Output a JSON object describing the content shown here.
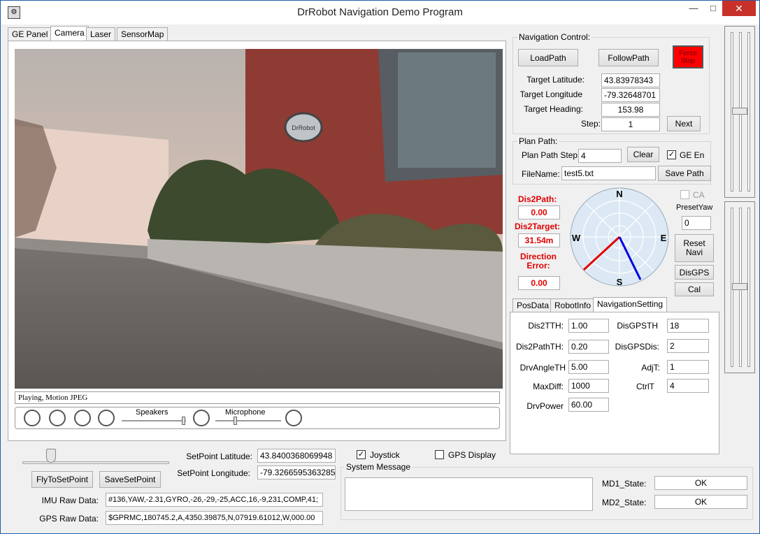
{
  "window": {
    "title": "DrRobot Navigation Demo Program",
    "minimize": "—",
    "maximize": "□",
    "close": "✕"
  },
  "tabs": [
    "GE Panel",
    "Camera",
    "Laser",
    "SensorMap"
  ],
  "camera": {
    "status": "Playing, Motion JPEG",
    "speakers_label": "Speakers",
    "microphone_label": "Microphone",
    "building_sign": "DrRobot"
  },
  "navigation_control": {
    "group_label": "Navigation Control:",
    "load_path": "LoadPath",
    "follow_path": "FollowPath",
    "force_stop": "Force Stop",
    "target_latitude_label": "Target Latitude:",
    "target_latitude": "43.83978343",
    "target_longitude_label": "Target Longitude",
    "target_longitude": "-79.32648701",
    "target_heading_label": "Target Heading:",
    "target_heading": "153.98",
    "step_label": "Step:",
    "step": "1",
    "next": "Next"
  },
  "plan_path": {
    "group_label": "Plan Path:",
    "step_label": "Plan Path Step :",
    "step": "4",
    "clear": "Clear",
    "ge_en_label": "GE En",
    "ge_en_checked": "✓",
    "filename_label": "FileName:",
    "filename": "test5.txt",
    "save_path": "Save Path"
  },
  "status": {
    "dis2path_label": "Dis2Path:",
    "dis2path": "0.00",
    "dis2target_label": "Dis2Target:",
    "dis2target": "31.54m",
    "direction_error_label": "Direction Error:",
    "direction_error": "0.00"
  },
  "compass": {
    "n": "N",
    "s": "S",
    "e": "E",
    "w": "W"
  },
  "right_controls": {
    "ca_label": "CA",
    "preset_yaw_label": "PresetYaw",
    "preset_yaw": "0",
    "reset_navi": "Reset Navi",
    "dis_gps": "DisGPS",
    "cal": "Cal"
  },
  "subtabs": [
    "PosData",
    "RobotInfo",
    "NavigationSetting"
  ],
  "nav_setting": {
    "dis2tth_label": "Dis2TTH:",
    "dis2tth": "1.00",
    "dis2pathth_label": "Dis2PathTH:",
    "dis2pathth": "0.20",
    "drvangleth_label": "DrvAngleTH",
    "drvangleth": "5.00",
    "maxdiff_label": "MaxDiff:",
    "maxdiff": "1000",
    "drvpower_label": "DrvPower",
    "drvpower": "60.00",
    "disgpsth_label": "DisGPSTH",
    "disgpsth": "18",
    "disgpsdis_label": "DisGPSDis:",
    "disgpsdis": "2",
    "adjt_label": "AdjT:",
    "adjt": "1",
    "ctrlt_label": "CtrlT",
    "ctrlt": "4"
  },
  "bottom": {
    "setpoint_lat_label": "SetPoint Latitude:",
    "setpoint_lat": "43.8400368069948",
    "setpoint_lon_label": "SetPoint Longitude:",
    "setpoint_lon": "-79.3266595363285",
    "fly_to_setpoint": "FlyToSetPoint",
    "save_setpoint": "SaveSetPoint",
    "joystick_label": "Joystick",
    "joystick_checked": "✓",
    "gps_display_label": "GPS Display",
    "system_message_label": "System Message",
    "imu_label": "IMU Raw Data:",
    "imu_value": "#136,YAW,-2.31,GYRO,-26,-29,-25,ACC,16,-9,231,COMP,41;",
    "gps_label": "GPS Raw Data:",
    "gps_value": "$GPRMC,180745.2,A,4350.39875,N,07919.61012,W,000.00",
    "md1_label": "MD1_State:",
    "md1_value": "OK",
    "md2_label": "MD2_State:",
    "md2_value": "OK"
  },
  "colors": {
    "force_stop_bg": "#ff0000",
    "status_red": "#e00000",
    "compass_fill": "#dce9f5",
    "path_line_red": "#e00000",
    "path_line_blue": "#0000e0"
  }
}
